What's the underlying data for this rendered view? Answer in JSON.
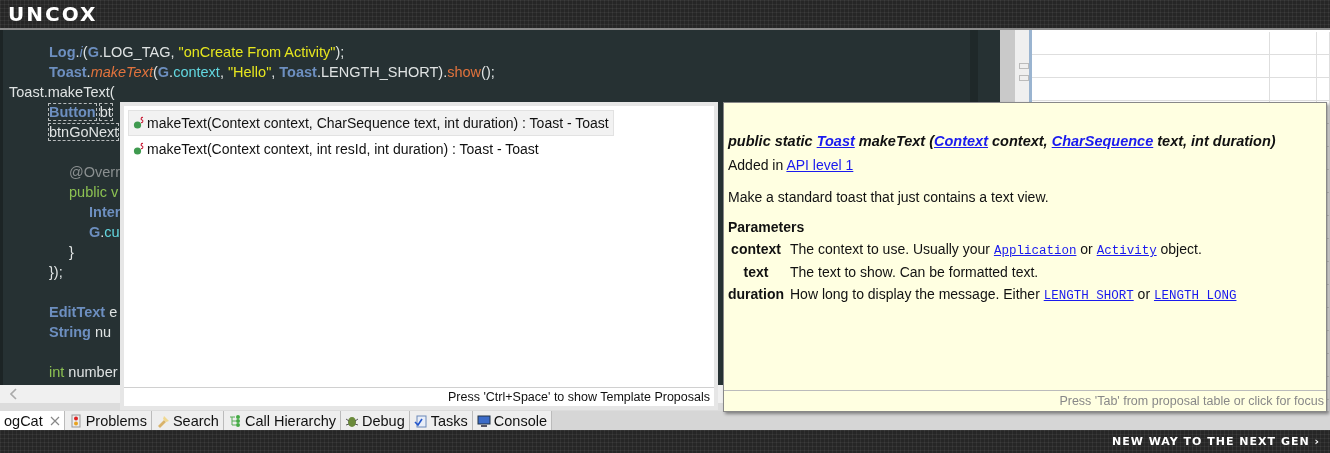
{
  "header": {
    "logo": "UNCOX"
  },
  "editor": {
    "lines": [
      {
        "kind": "code",
        "tokens": [
          {
            "text": "\t\tLog",
            "kind": "type"
          },
          {
            "text": ".",
            "kind": "plain"
          },
          {
            "text": "i",
            "kind": "static"
          },
          {
            "text": "(",
            "kind": "plain"
          },
          {
            "text": "G",
            "kind": "type"
          },
          {
            "text": ".LOG_TAG, ",
            "kind": "plain"
          },
          {
            "text": "\"onCreate From Activity\"",
            "kind": "string"
          },
          {
            "text": ");",
            "kind": "plain"
          }
        ]
      },
      {
        "kind": "code",
        "tokens": [
          {
            "text": "\t\tToast",
            "kind": "type"
          },
          {
            "text": ".",
            "kind": "plain"
          },
          {
            "text": "makeText",
            "kind": "static-method"
          },
          {
            "text": "(",
            "kind": "plain"
          },
          {
            "text": "G",
            "kind": "type"
          },
          {
            "text": ".",
            "kind": "plain"
          },
          {
            "text": "context",
            "kind": "field"
          },
          {
            "text": ", ",
            "kind": "plain"
          },
          {
            "text": "\"Hello\"",
            "kind": "string"
          },
          {
            "text": ", ",
            "kind": "plain"
          },
          {
            "text": "Toast",
            "kind": "type"
          },
          {
            "text": ".LENGTH_SHORT).",
            "kind": "plain"
          },
          {
            "text": "show",
            "kind": "method"
          },
          {
            "text": "();",
            "kind": "plain"
          }
        ]
      },
      {
        "kind": "code",
        "tokens": [
          {
            "text": "Toast.makeText(",
            "kind": "plain"
          }
        ]
      },
      {
        "kind": "code",
        "tokens": [
          {
            "text": "\t\tButton",
            "kind": "linked-type"
          },
          {
            "text": " bt",
            "kind": "linked"
          }
        ]
      },
      {
        "kind": "code",
        "tokens": [
          {
            "text": "\t\tbtnGoNext",
            "kind": "linked"
          }
        ]
      },
      {
        "kind": "blank"
      },
      {
        "kind": "code",
        "tokens": [
          {
            "text": "\t\t\t@Overr",
            "kind": "annotation"
          }
        ]
      },
      {
        "kind": "code",
        "tokens": [
          {
            "text": "\t\t\tpublic v",
            "kind": "keyword"
          }
        ]
      },
      {
        "kind": "code",
        "tokens": [
          {
            "text": "\t\t\t\tInter",
            "kind": "type"
          }
        ]
      },
      {
        "kind": "code",
        "tokens": [
          {
            "text": "\t\t\t\tG",
            "kind": "type"
          },
          {
            "text": ".",
            "kind": "plain"
          },
          {
            "text": "cu",
            "kind": "field"
          }
        ]
      },
      {
        "kind": "code",
        "tokens": [
          {
            "text": "\t\t\t}",
            "kind": "plain"
          }
        ]
      },
      {
        "kind": "code",
        "tokens": [
          {
            "text": "\t\t});",
            "kind": "plain"
          }
        ]
      },
      {
        "kind": "blank"
      },
      {
        "kind": "code",
        "tokens": [
          {
            "text": "\t\tEditText",
            "kind": "type"
          },
          {
            "text": " e",
            "kind": "plain"
          }
        ]
      },
      {
        "kind": "code",
        "tokens": [
          {
            "text": "\t\tString",
            "kind": "type"
          },
          {
            "text": " nu",
            "kind": "plain"
          }
        ]
      },
      {
        "kind": "blank"
      },
      {
        "kind": "code",
        "tokens": [
          {
            "text": "\t\tint",
            "kind": "keyword"
          },
          {
            "text": " number",
            "kind": "plain"
          }
        ]
      }
    ]
  },
  "proposals": {
    "items": [
      {
        "text": "makeText(Context context, CharSequence text, int duration) : Toast - Toast",
        "selected": true
      },
      {
        "text": "makeText(Context context, int resId, int duration) : Toast - Toast",
        "selected": false
      }
    ],
    "hint": "Press 'Ctrl+Space' to show Template Proposals"
  },
  "doc": {
    "signature": [
      {
        "text": "public static ",
        "link": false
      },
      {
        "text": "Toast",
        "link": true
      },
      {
        "text": " makeText (",
        "link": false
      },
      {
        "text": "Context",
        "link": true
      },
      {
        "text": " context, ",
        "link": false
      },
      {
        "text": "CharSequence",
        "link": true
      },
      {
        "text": " text, int duration)",
        "link": false
      }
    ],
    "added": [
      {
        "text": "Added in ",
        "link": false
      },
      {
        "text": "API level 1",
        "link": true
      }
    ],
    "description": "Make a standard toast that just contains a text view.",
    "params_heading": "Parameters",
    "params": [
      {
        "name": "context",
        "description": [
          {
            "text": "The context to use. Usually your ",
            "link": false
          },
          {
            "text": "Application",
            "link": true
          },
          {
            "text": " or ",
            "link": false
          },
          {
            "text": "Activity",
            "link": true
          },
          {
            "text": " object.",
            "link": false
          }
        ]
      },
      {
        "name": "text",
        "description": [
          {
            "text": "The text to show. Can be formatted text.",
            "link": false
          }
        ]
      },
      {
        "name": "duration",
        "description": [
          {
            "text": "How long to display the message. Either ",
            "link": false
          },
          {
            "text": "LENGTH_SHORT",
            "link": true
          },
          {
            "text": " or ",
            "link": false
          },
          {
            "text": "LENGTH_LONG",
            "link": true
          }
        ]
      }
    ],
    "hint": "Press 'Tab' from proposal table or click for focus"
  },
  "bottom_tabs": [
    {
      "label": "ogCat",
      "selected": true
    },
    {
      "label": "Problems",
      "selected": false
    },
    {
      "label": "Search",
      "selected": false
    },
    {
      "label": "Call Hierarchy",
      "selected": false
    },
    {
      "label": "Debug",
      "selected": false
    },
    {
      "label": "Tasks",
      "selected": false
    },
    {
      "label": "Console",
      "selected": false
    }
  ],
  "footer": {
    "slogan": "NEW WAY TO THE NEXT GEN ›"
  }
}
